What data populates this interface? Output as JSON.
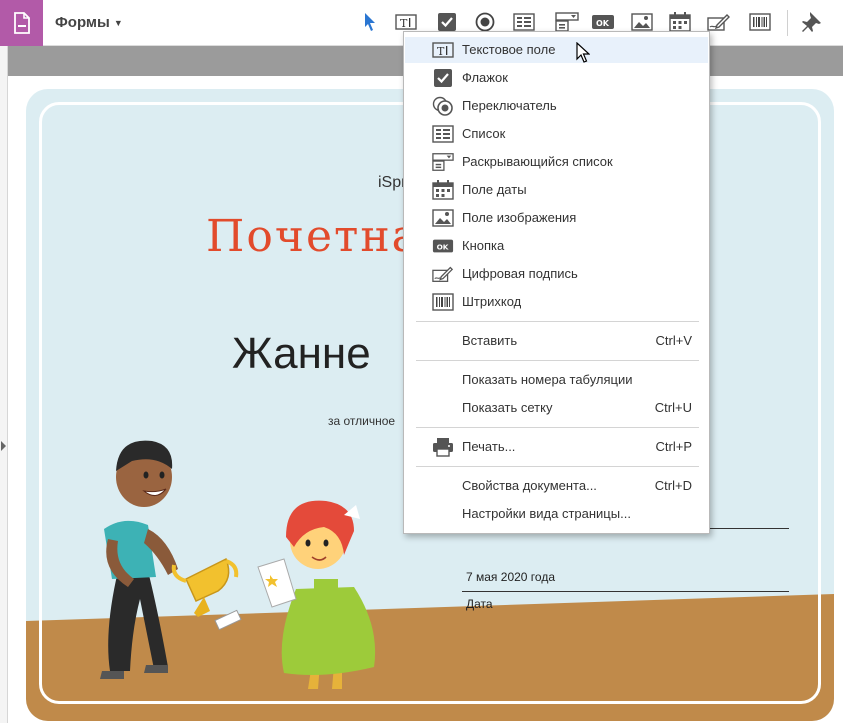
{
  "toolbar": {
    "forms_label": "Формы",
    "icons": [
      "select-arrow-icon",
      "text-field-icon",
      "checkbox-icon",
      "radio-button-icon",
      "list-box-icon",
      "dropdown-list-icon",
      "button-ok-icon",
      "image-field-icon",
      "date-field-icon",
      "digital-signature-icon",
      "barcode-icon",
      "pin-icon"
    ]
  },
  "colors": {
    "app_icon_bg": "#b25aa8",
    "title_red": "#e24b2c",
    "certificate_bg": "#dcedf2",
    "floor_brown": "#c08a4a",
    "menu_hover": "#e8f1fb"
  },
  "menu": {
    "form_items": [
      {
        "label": "Текстовое поле",
        "icon": "text-field-icon"
      },
      {
        "label": "Флажок",
        "icon": "checkbox-icon"
      },
      {
        "label": "Переключатель",
        "icon": "radio-button-icon"
      },
      {
        "label": "Список",
        "icon": "list-box-icon"
      },
      {
        "label": "Раскрывающийся список",
        "icon": "dropdown-list-icon"
      },
      {
        "label": "Поле даты",
        "icon": "date-field-icon"
      },
      {
        "label": "Поле изображения",
        "icon": "image-field-icon"
      },
      {
        "label": "Кнопка",
        "icon": "button-ok-icon"
      },
      {
        "label": "Цифровая подпись",
        "icon": "digital-signature-icon"
      },
      {
        "label": "Штрихкод",
        "icon": "barcode-icon"
      }
    ],
    "paste": {
      "label": "Вставить",
      "shortcut": "Ctrl+V"
    },
    "show_tab_order": {
      "label": "Показать номера табуляции"
    },
    "show_grid": {
      "label": "Показать сетку",
      "shortcut": "Ctrl+U"
    },
    "print": {
      "label": "Печать...",
      "shortcut": "Ctrl+P"
    },
    "doc_properties": {
      "label": "Свойства документа...",
      "shortcut": "Ctrl+D"
    },
    "page_view_settings": {
      "label": "Настройки вида страницы..."
    }
  },
  "certificate": {
    "company": "iSpr",
    "title": "Почетна",
    "recipient": "Жанне",
    "reason": "за отличное",
    "date_value": "7 мая 2020 года",
    "date_label": "Дата"
  }
}
